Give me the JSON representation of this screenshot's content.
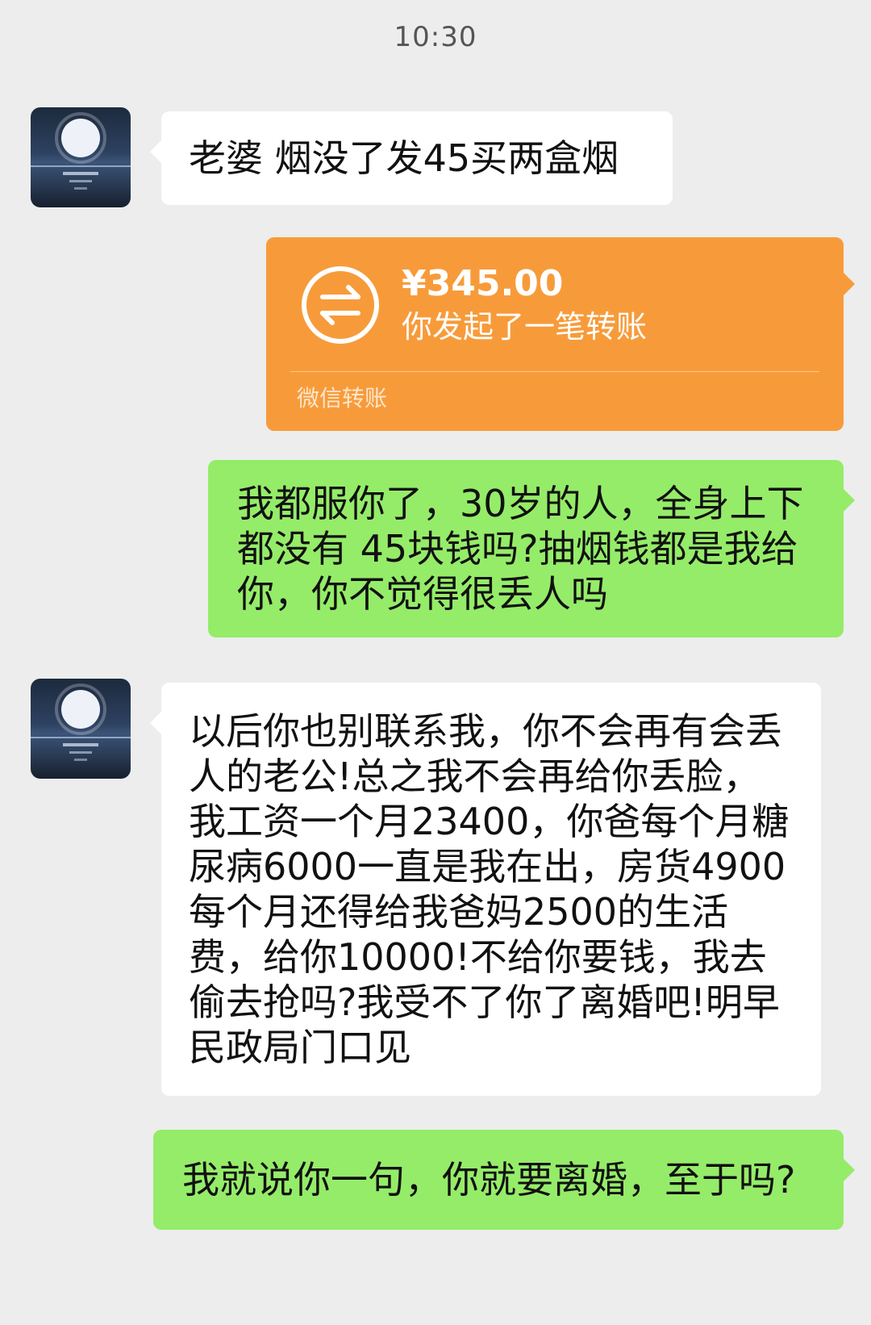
{
  "chat": {
    "timestamp": "10:30",
    "messages": [
      {
        "sender": "other",
        "text": "老婆 烟没了发45买两盒烟"
      },
      {
        "sender": "me",
        "type": "transfer",
        "amount": "¥345.00",
        "desc": "你发起了一笔转账",
        "footer": "微信转账"
      },
      {
        "sender": "me",
        "text": "我都服你了，30岁的人，全身上下都没有 45块钱吗?抽烟钱都是我给你，你不觉得很丢人吗"
      },
      {
        "sender": "other",
        "text": "以后你也别联系我，你不会再有会丢人的老公!总之我不会再给你丢脸，我工资一个月23400，你爸每个月糖尿病6000一直是我在出，房货4900每个月还得给我爸妈2500的生活费，给你10000!不给你要钱，我去偷去抢吗?我受不了你了离婚吧!明早民政局门口见"
      },
      {
        "sender": "me",
        "text": "我就说你一句，你就要离婚，至于吗?"
      }
    ]
  },
  "colors": {
    "background": "#ededed",
    "sent_bubble": "#95ec69",
    "received_bubble": "#ffffff",
    "transfer_card": "#f79b3a"
  },
  "icons": {
    "avatar": "moon-over-sea-avatar",
    "transfer": "transfer-arrows-icon"
  }
}
